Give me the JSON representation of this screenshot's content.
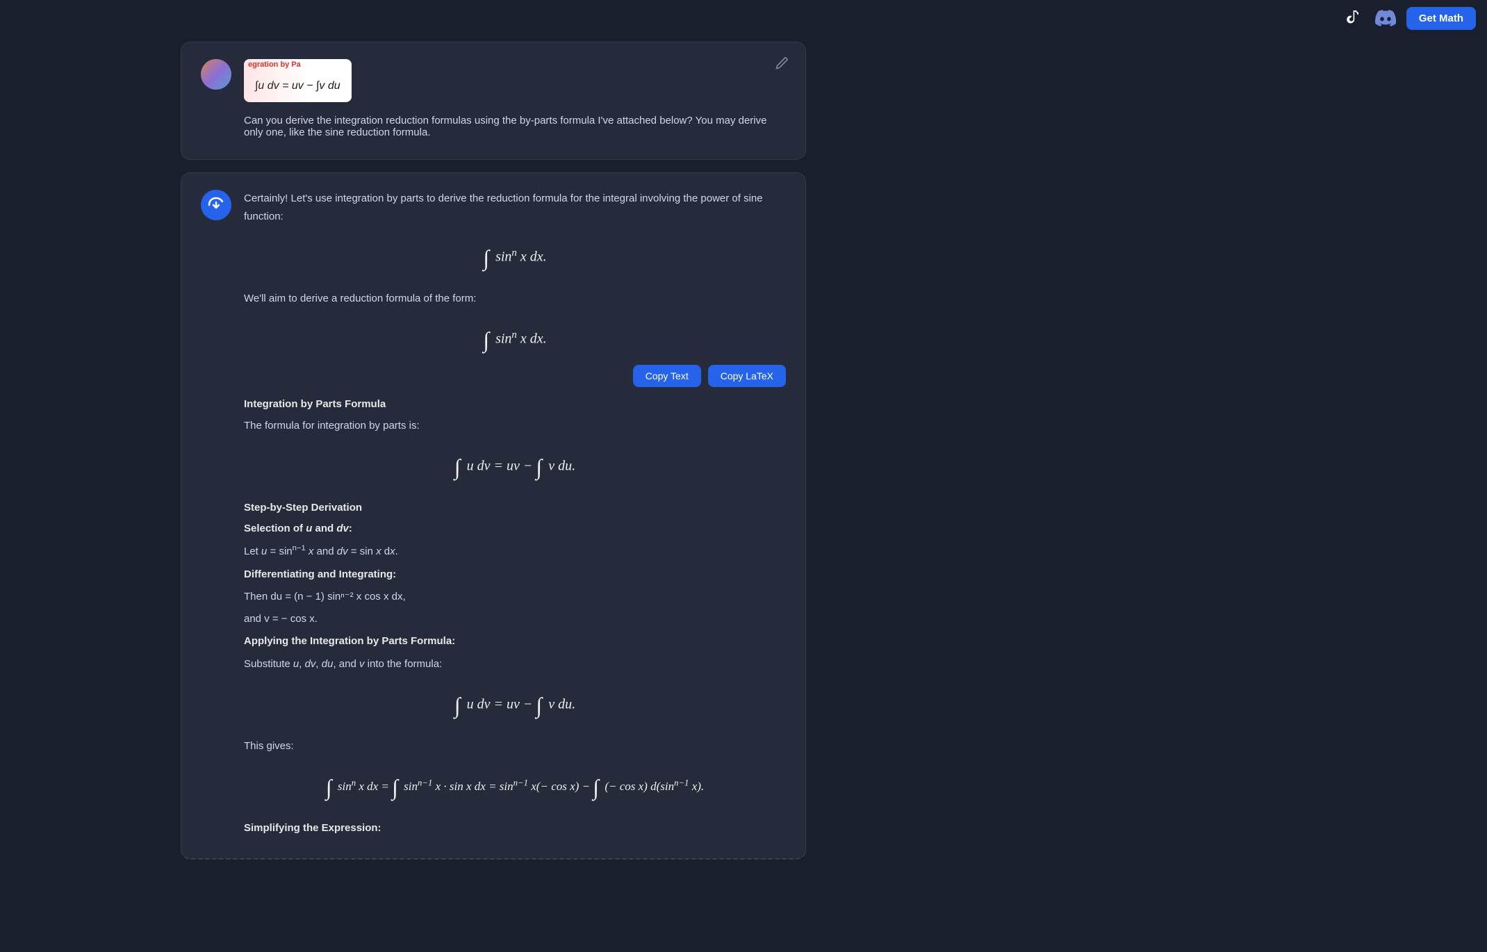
{
  "topbar": {
    "tiktok_icon": "♪",
    "discord_icon": "🎮",
    "get_math_label": "Get Math"
  },
  "user_message": {
    "formula_title": "egration by Pa",
    "formula_text": "∫u dv = uv − ∫v du",
    "text": "Can you derive the integration reduction formulas using the by-parts formula I've attached below? You may derive only one, like the sine reduction formula."
  },
  "ai_message": {
    "intro": "Certainly! Let's use integration by parts to derive the reduction formula for the integral involving the power of sine function:",
    "formula1": "∫ sinⁿ x dx.",
    "aim_text": "We'll aim to derive a reduction formula of the form:",
    "formula2": "∫ sinⁿ x dx.",
    "copy_text_label": "Copy Text",
    "copy_latex_label": "Copy LaTeX",
    "section1_title": "Integration by Parts Formula",
    "section1_text": "The formula for integration by parts is:",
    "formula3": "∫ u dv = uv − ∫ v du.",
    "section2_title": "Step-by-Step Derivation",
    "selection_bold": "Selection of u and dv:",
    "selection_text": "Let u = sinⁿ⁻¹ x and dv = sin x dx.",
    "diff_bold": "Differentiating and Integrating:",
    "diff_text1": "Then du = (n − 1) sinⁿ⁻² x cos x dx,",
    "diff_text2": "and v = − cos x.",
    "applying_bold": "Applying the Integration by Parts Formula:",
    "applying_text": "Substitute u, dv, du, and v into the formula:",
    "formula4": "∫ u dv = uv − ∫ v du.",
    "gives_text": "This gives:",
    "formula5": "∫ sinⁿ x dx = ∫ sinⁿ⁻¹ x · sin x dx = sinⁿ⁻¹ x(− cos x) − ∫ (− cos x) d(sinⁿ⁻¹ x).",
    "simplify_bold": "Simplifying the Expression:"
  }
}
